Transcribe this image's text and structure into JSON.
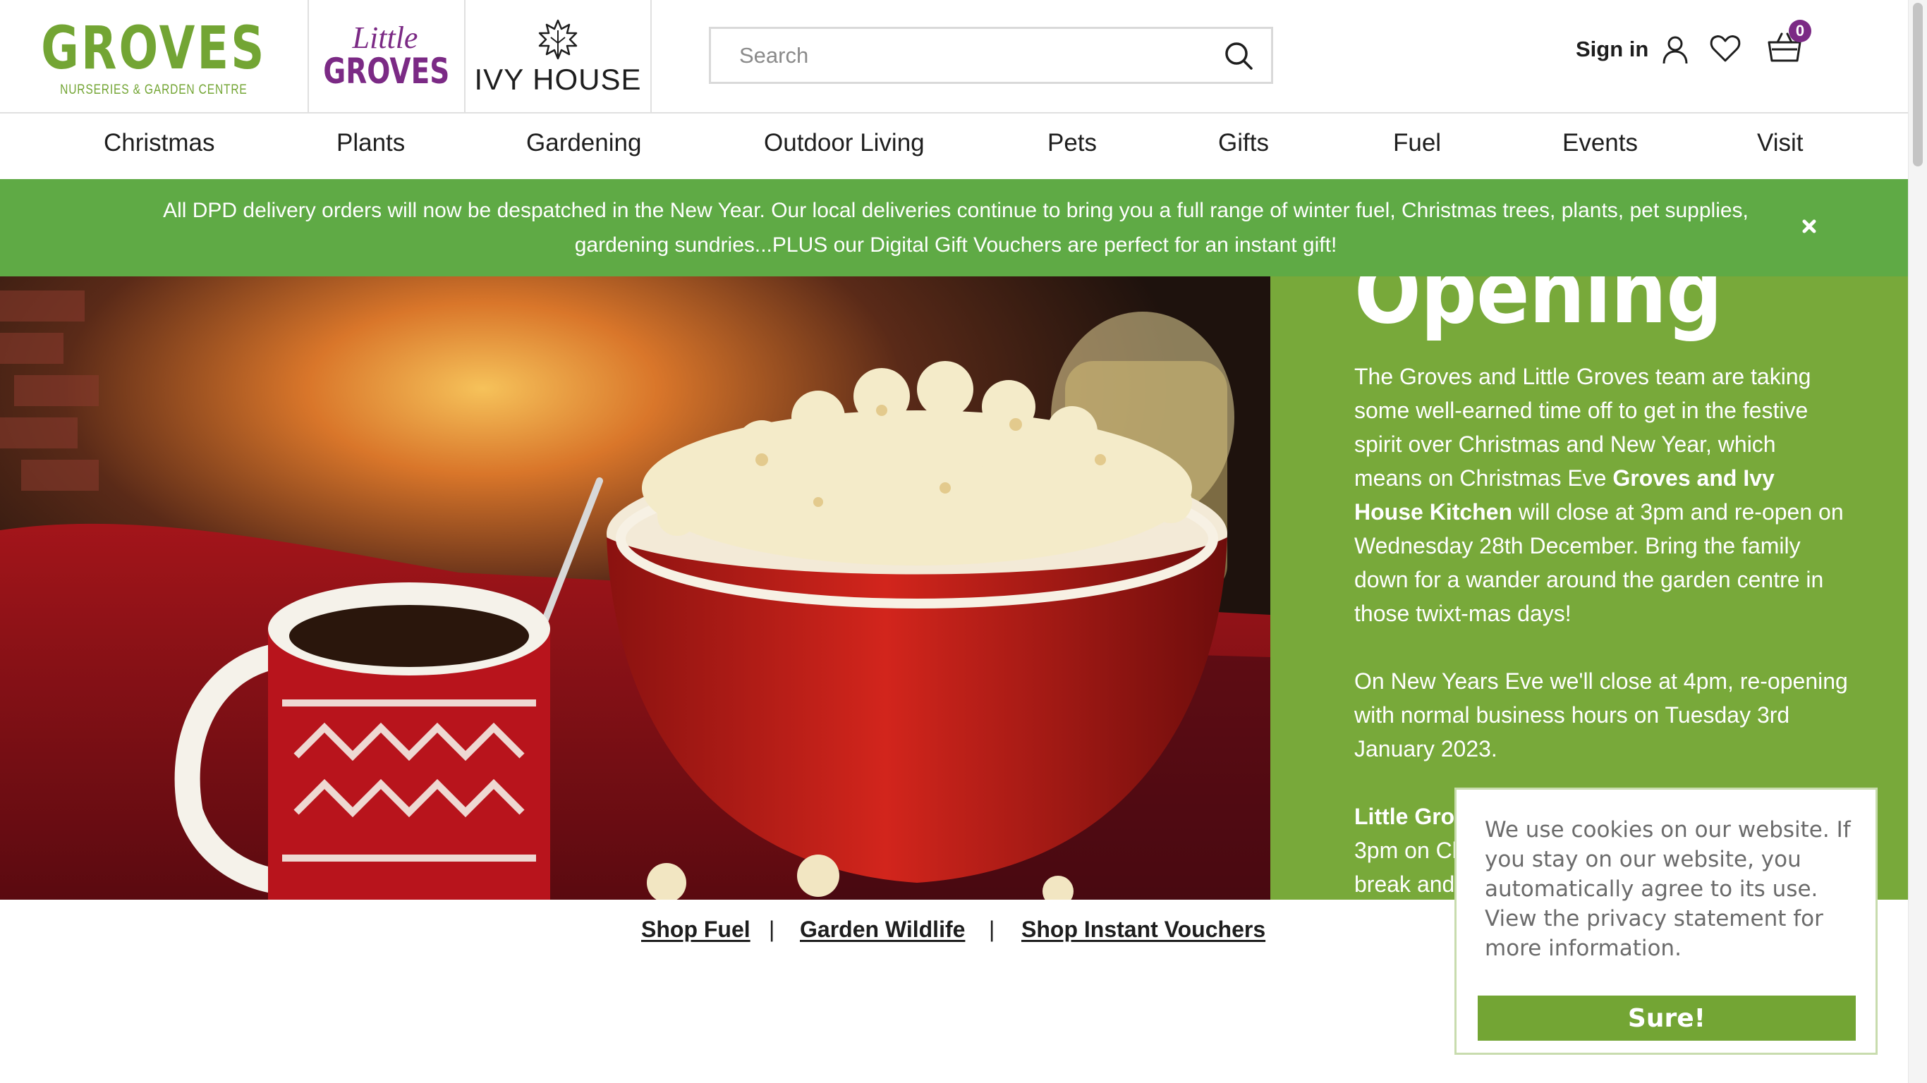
{
  "header": {
    "groves_logo_text": "GROVES",
    "groves_logo_tagline": "NURSERIES & GARDEN CENTRE",
    "little_groves_logo_top": "Little",
    "little_groves_logo_bottom": "GROVES",
    "ivy_house_logo_text": "IVY HOUSE",
    "search_placeholder": "Search",
    "sign_in_label": "Sign in",
    "cart_count": "0"
  },
  "nav": {
    "items": [
      "Christmas",
      "Plants",
      "Gardening",
      "Outdoor Living",
      "Pets",
      "Gifts",
      "Fuel",
      "Events",
      "Visit"
    ]
  },
  "notice": {
    "line1": "All DPD delivery orders will now be despatched in the New Year. Our local deliveries continue to bring you a full range of winter fuel, Christmas trees, plants, pet supplies,",
    "line2": "gardening sundries...PLUS our Digital Gift Vouchers are perfect for an instant gift!"
  },
  "hero": {
    "title": "Opening",
    "p1_a": "The Groves and Little Groves team are taking some well-earned time off to get in the festive spirit over Christmas and New Year, which means on Christmas Eve ",
    "p1_bold": "Groves and Ivy House Kitchen",
    "p1_b": " will close at 3pm and re-open on Wednesday 28th December.  Bring the family down for a wander around the garden centre in those twixt-mas days!",
    "p2": "On New Years Eve we'll close at 4pm, re-opening with normal business hours on Tuesday 3rd January 2023.",
    "p3_bold": "Little Gro",
    "p3_line2": "3pm on Cl",
    "p3_line3": "break and"
  },
  "links": {
    "shop_fuel": "Shop Fuel",
    "garden_wildlife": "Garden Wildlife",
    "shop_vouchers": "Shop Instant Vouchers",
    "separator": "|"
  },
  "cookie": {
    "message": "We use cookies on our website. If you stay on our website, you automatically agree to its use. View the privacy statement for more information.",
    "button_label": "Sure!"
  },
  "colors": {
    "brand_green": "#73a534",
    "notice_green": "#5faa45",
    "panel_green": "#78a93a",
    "little_groves_purple": "#7b2a85"
  }
}
